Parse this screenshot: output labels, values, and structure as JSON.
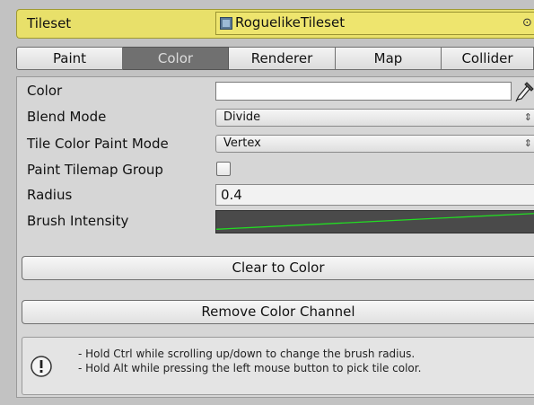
{
  "tileset": {
    "label": "Tileset",
    "value": "RoguelikeTileset",
    "picker_glyph": "⊙"
  },
  "tabs": [
    {
      "label": "Paint",
      "active": false
    },
    {
      "label": "Color",
      "active": true
    },
    {
      "label": "Renderer",
      "active": false
    },
    {
      "label": "Map",
      "active": false
    },
    {
      "label": "Collider",
      "active": false
    }
  ],
  "fields": {
    "color_label": "Color",
    "color_value": "#ffffff",
    "blend_mode_label": "Blend Mode",
    "blend_mode_value": "Divide",
    "tile_color_paint_mode_label": "Tile Color Paint Mode",
    "tile_color_paint_mode_value": "Vertex",
    "paint_tilemap_group_label": "Paint Tilemap Group",
    "paint_tilemap_group_checked": false,
    "radius_label": "Radius",
    "radius_value": "0.4",
    "brush_intensity_label": "Brush Intensity",
    "dropdown_arrows": "⇕"
  },
  "buttons": {
    "clear_to_color": "Clear to Color",
    "remove_color_channel": "Remove Color Channel"
  },
  "help": {
    "line1": "- Hold Ctrl while scrolling up/down to change the brush radius.",
    "line2": "- Hold Alt while pressing the left mouse button to pick tile color."
  },
  "colors": {
    "tileset_bar": "#e8e06a",
    "active_tab": "#707070",
    "curve_line": "#22dd22",
    "curve_background": "#4a4a4a"
  }
}
